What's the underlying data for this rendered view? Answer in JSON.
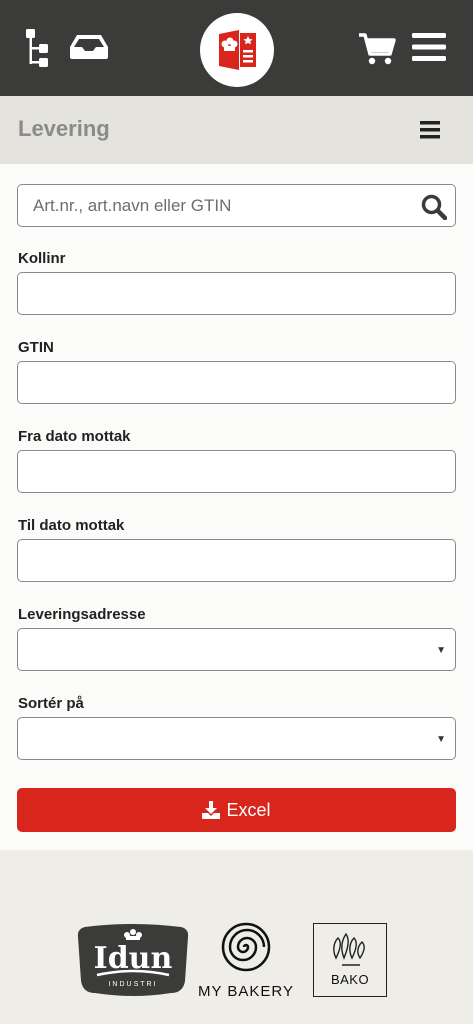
{
  "topbar": {
    "icons": [
      "tree-icon",
      "inbox-icon",
      "logo",
      "cart-icon",
      "menu-icon"
    ],
    "background": "#3b3b39"
  },
  "section": {
    "title": "Levering"
  },
  "search": {
    "placeholder": "Art.nr., art.navn eller GTIN"
  },
  "fields": {
    "kollinr": "Kollinr",
    "gtin": "GTIN",
    "fra_dato": "Fra dato mottak",
    "til_dato": "Til dato mottak",
    "leveringsadresse": "Leveringsadresse",
    "sorter": "Sortér på"
  },
  "excel": {
    "label": "Excel",
    "color": "#d9261c"
  },
  "footer": {
    "idun": {
      "name": "Idun",
      "sub": "INDUSTRI"
    },
    "mybakery": "MY BAKERY",
    "bako": "BAKO"
  }
}
